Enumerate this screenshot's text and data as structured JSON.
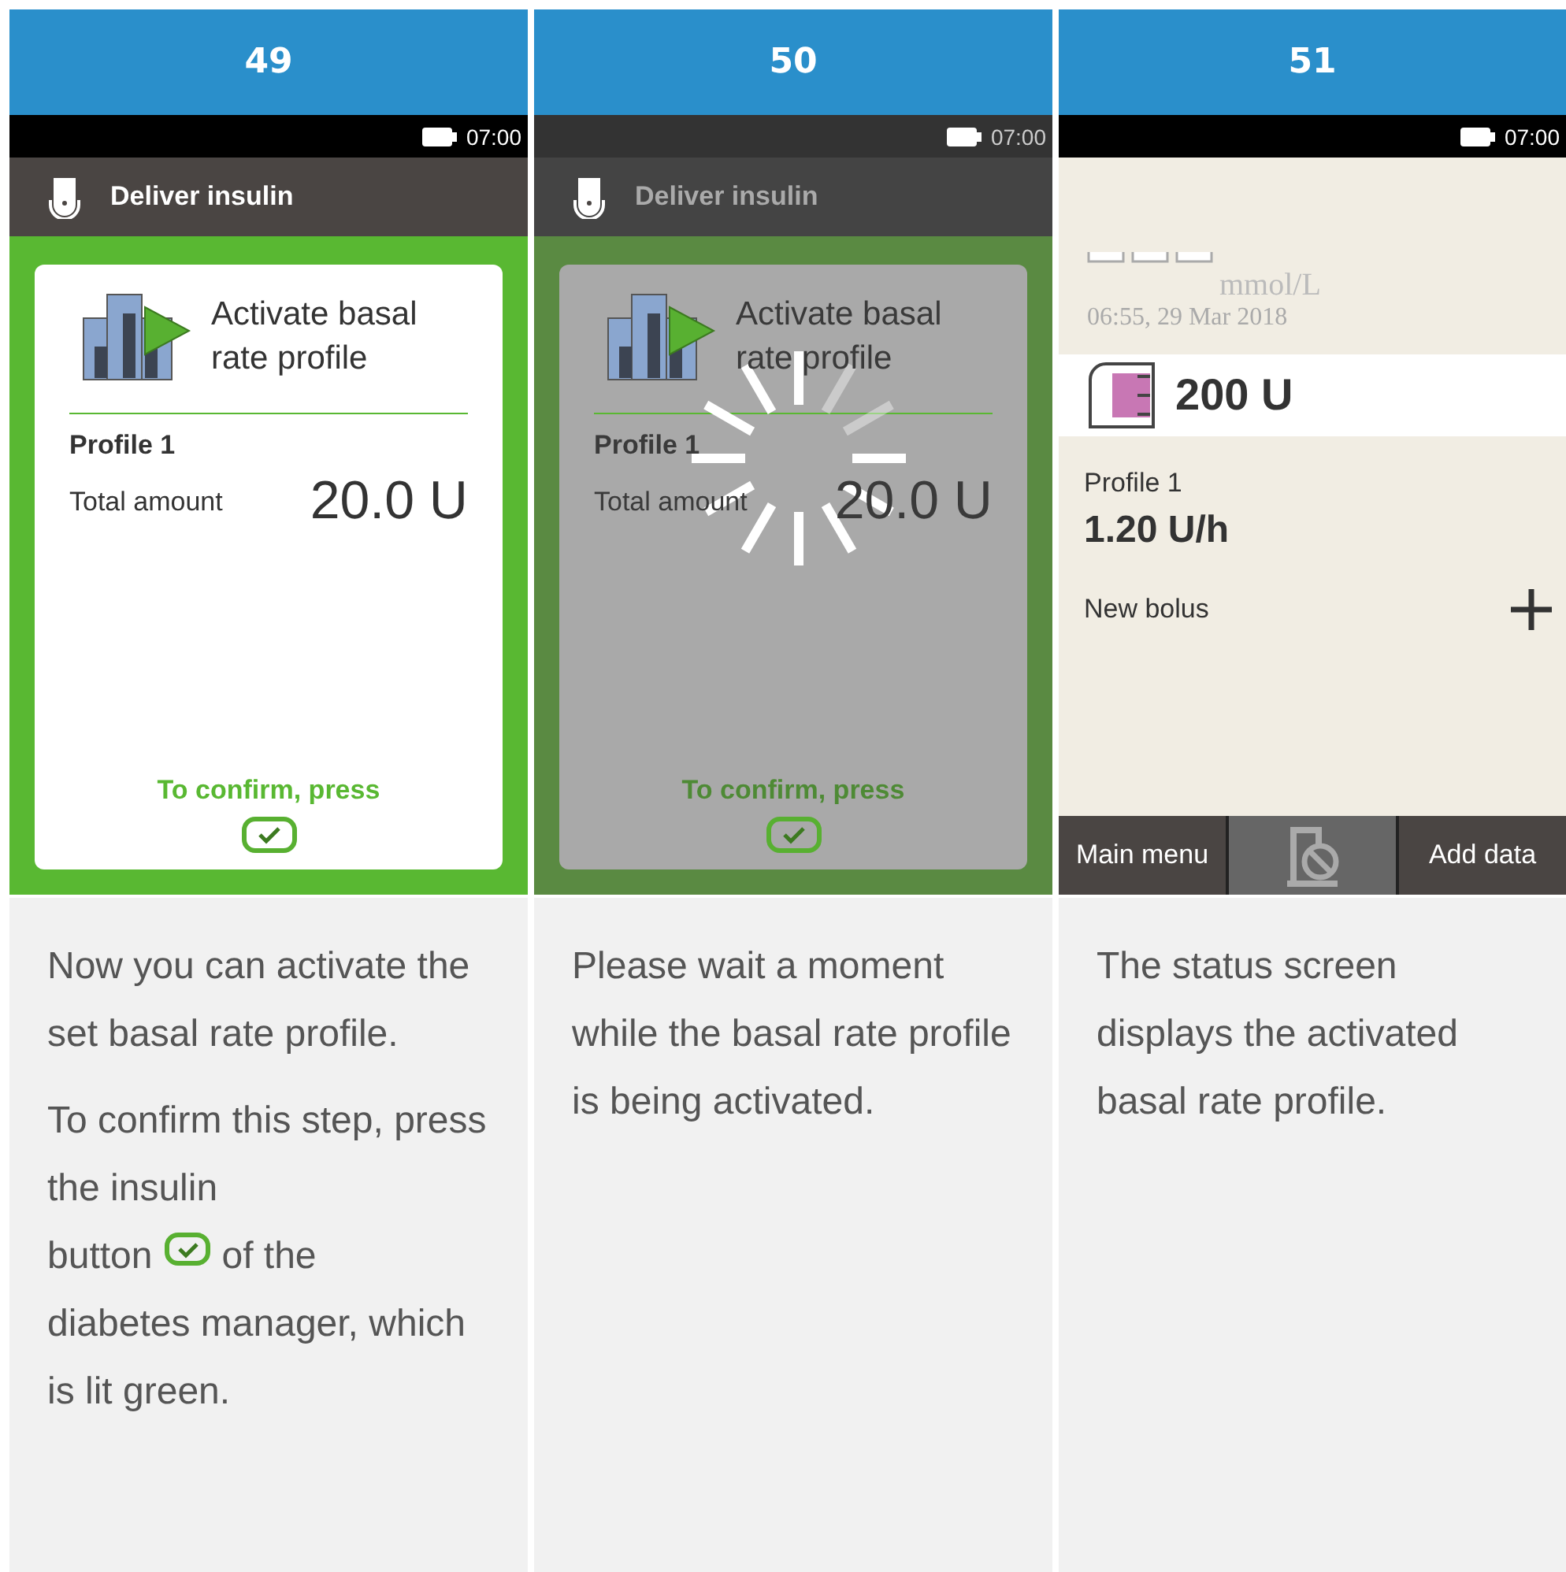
{
  "steps": [
    {
      "number": "49",
      "screen": {
        "kind": "confirm",
        "busy": false,
        "time": "07:00",
        "title": "Deliver insulin",
        "card_title": "Activate basal rate profile",
        "profile": "Profile 1",
        "amount_label": "Total amount",
        "amount": "20.0 U",
        "confirm_text": "To confirm, press"
      },
      "paragraphs": [
        [
          {
            "kind": "text",
            "text": "Now you can activate the set basal rate profile."
          }
        ],
        [
          {
            "kind": "text",
            "text": "To confirm this step, press the insulin"
          },
          {
            "kind": "text",
            "text": "button"
          },
          {
            "kind": "confirm-icon"
          },
          {
            "kind": "text",
            "text": "of the"
          },
          {
            "kind": "text",
            "text": "diabetes manager, which is lit green."
          }
        ]
      ]
    },
    {
      "number": "50",
      "screen": {
        "kind": "confirm",
        "busy": true,
        "time": "07:00",
        "title": "Deliver insulin",
        "card_title": "Activate basal rate profile",
        "profile": "Profile 1",
        "amount_label": "Total amount",
        "amount": "20.0 U",
        "confirm_text": "To confirm, press"
      },
      "paragraphs": [
        [
          {
            "kind": "text",
            "text": "Please wait a moment while the basal rate profile is being activated."
          }
        ]
      ]
    },
    {
      "number": "51",
      "screen": {
        "kind": "status",
        "time": "07:00",
        "unit": "mmol/L",
        "timestamp": "06:55, 29 Mar 2018",
        "reservoir": "200 U",
        "profile": "Profile 1",
        "rate": "1.20 U/h",
        "bolus_label": "New bolus",
        "left_key": "Main menu",
        "right_key": "Add data"
      },
      "paragraphs": [
        [
          {
            "kind": "text",
            "text": "The status screen displays the activated basal rate profile."
          }
        ]
      ]
    }
  ]
}
